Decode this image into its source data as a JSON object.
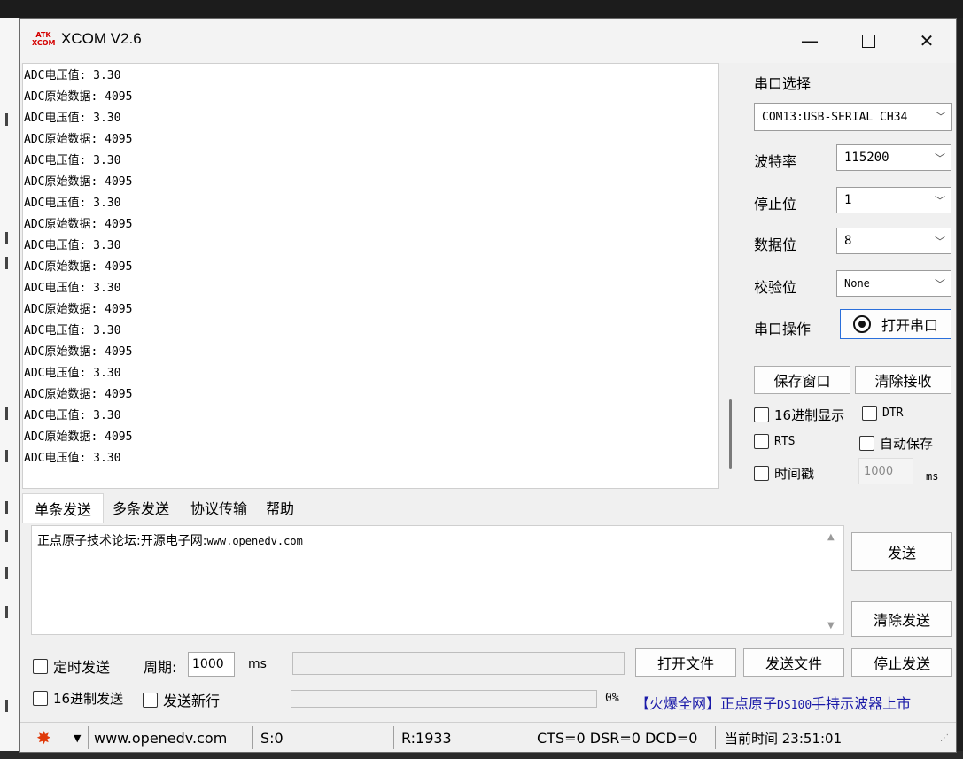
{
  "window": {
    "logo_top": "ATK",
    "logo_bottom": "XCOM",
    "title": "XCOM V2.6",
    "minimize_glyph": "—",
    "close_glyph": "✕"
  },
  "receive": {
    "lines": [
      "ADC电压值: 3.30",
      "ADC原始数据: 4095",
      "ADC电压值: 3.30",
      "ADC原始数据: 4095",
      "ADC电压值: 3.30",
      "ADC原始数据: 4095",
      "ADC电压值: 3.30",
      "ADC原始数据: 4095",
      "ADC电压值: 3.30",
      "ADC原始数据: 4095",
      "ADC电压值: 3.30",
      "ADC原始数据: 4095",
      "ADC电压值: 3.30",
      "ADC原始数据: 4095",
      "ADC电压值: 3.30",
      "ADC原始数据: 4095",
      "ADC电压值: 3.30",
      "ADC原始数据: 4095",
      "ADC电压值: 3.30"
    ]
  },
  "serial": {
    "port_select_label": "串口选择",
    "port_value": "COM13:USB-SERIAL CH34",
    "baud_label": "波特率",
    "baud_value": "115200",
    "stop_label": "停止位",
    "stop_value": "1",
    "data_label": "数据位",
    "data_value": "8",
    "parity_label": "校验位",
    "parity_value": "None",
    "op_label": "串口操作",
    "open_label": "打开串口",
    "save_window_label": "保存窗口",
    "clear_rx_label": "清除接收",
    "hex_display_label": "16进制显示",
    "dtr_label": "DTR",
    "rts_label": "RTS",
    "auto_save_label": "自动保存",
    "timestamp_label": "时间戳",
    "timestamp_value": "1000",
    "timestamp_unit": "ms"
  },
  "tabs": [
    "单条发送",
    "多条发送",
    "协议传输",
    "帮助"
  ],
  "send": {
    "text_prefix": "正点原子技术论坛:开源电子网:",
    "text_url": "www.openedv.com",
    "send_label": "发送",
    "clear_send_label": "清除发送",
    "timed_send_label": "定时发送",
    "period_label": "周期:",
    "period_value": "1000",
    "period_unit": "ms",
    "open_file_label": "打开文件",
    "send_file_label": "发送文件",
    "stop_send_label": "停止发送",
    "hex_send_label": "16进制发送",
    "newline_label": "发送新行",
    "progress_percent": "0%",
    "ad_part1": "【火爆全网】正点原子",
    "ad_mono": "DS100",
    "ad_part2": "手持示波器上市"
  },
  "status": {
    "url": "www.openedv.com",
    "sent": "S:0",
    "received": "R:1933",
    "signals": "CTS=0 DSR=0 DCD=0",
    "time": "当前时间 23:51:01"
  },
  "colors": {
    "ad_text": "#1a1aa8",
    "gear_icon": "#e03a0a",
    "logo": "#d40000"
  }
}
